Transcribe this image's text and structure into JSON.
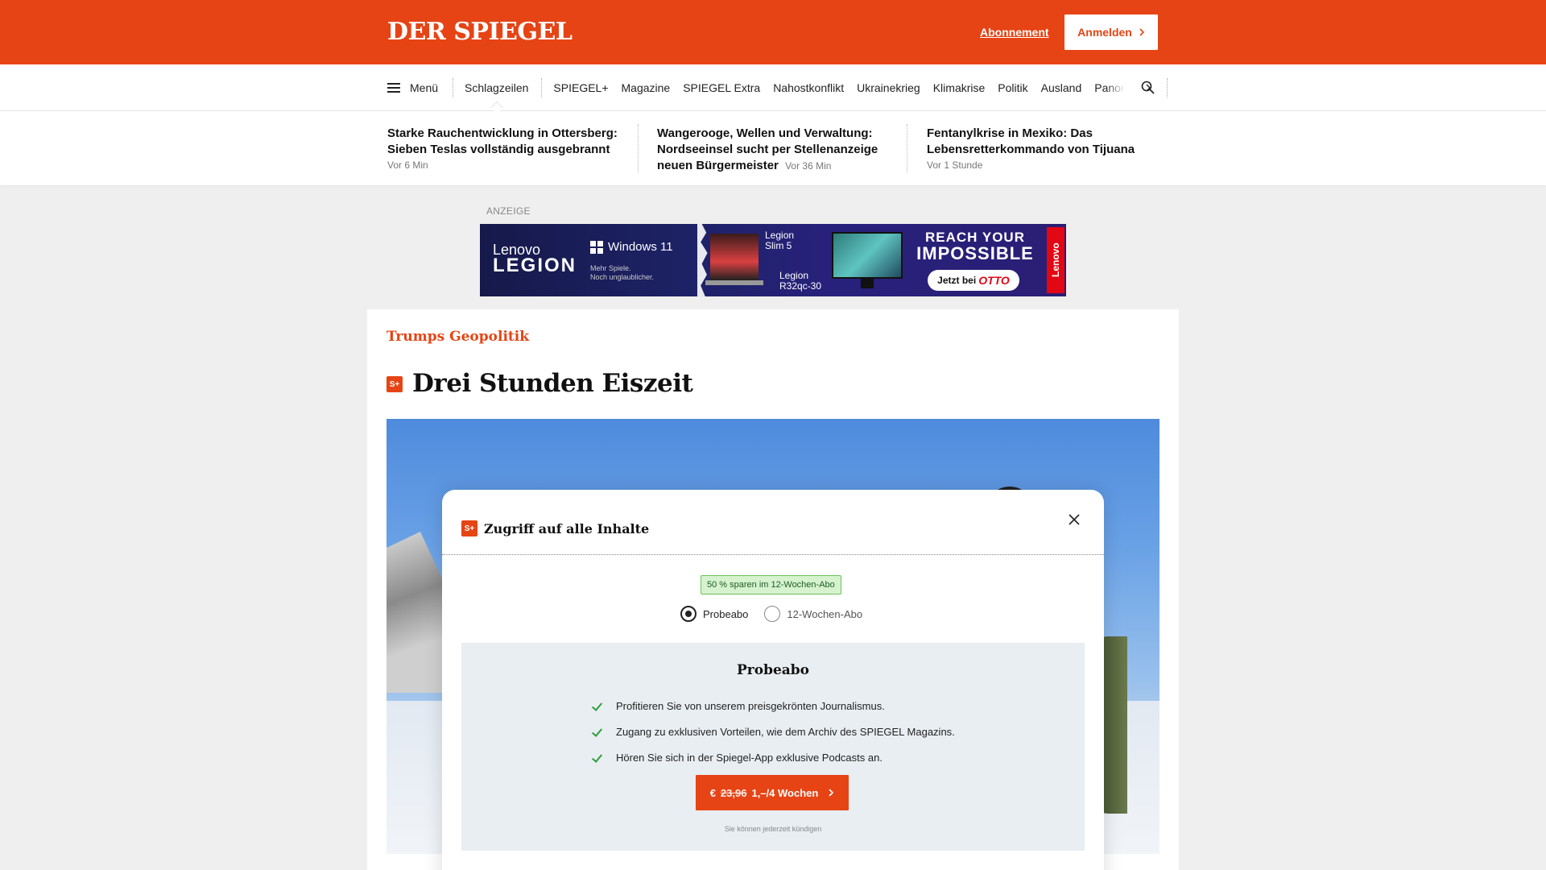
{
  "header": {
    "logo": "DER SPIEGEL",
    "subscription_link": "Abonnement",
    "login_label": "Anmelden",
    "brand_color": "#e64415"
  },
  "nav": {
    "menu_label": "Menü",
    "items": [
      "Schlagzeilen",
      "SPIEGEL+",
      "Magazine",
      "SPIEGEL Extra",
      "Nahostkonflikt",
      "Ukrainekrieg",
      "Klimakrise",
      "Politik",
      "Ausland",
      "Panor"
    ],
    "active_item": "Schlagzeilen",
    "more_icon": "chevron-right-icon",
    "search_icon": "search-icon"
  },
  "teasers": [
    {
      "title": "Starke Rauchentwicklung in Ottersberg: Sieben Teslas vollständig ausgebrannt",
      "time": "Vor 6 Min"
    },
    {
      "title": "Wangerooge, Wellen und Verwaltung: Nordseeinsel sucht per Stellenanzeige neuen Bürgermeister",
      "time": "Vor 36 Min"
    },
    {
      "title": "Fentanylkrise in Mexiko: Das Lebensretterkommando von Tijuana",
      "time": "Vor 1 Stunde"
    }
  ],
  "ad": {
    "label": "ANZEIGE",
    "brand_top": "Lenovo",
    "brand_main": "LEGION",
    "os": "Windows 11",
    "os_sub_1": "Mehr Spiele.",
    "os_sub_2": "Noch unglaublicher.",
    "product_1_a": "Legion",
    "product_1_b": "Slim 5",
    "product_2_a": "Legion",
    "product_2_b": "R32qc-30",
    "slogan_1": "REACH YOUR",
    "slogan_2": "IMPOSSIBLE",
    "cta_prefix": "Jetzt bei",
    "cta_shop": "OTTO",
    "side_brand": "Lenovo"
  },
  "article": {
    "kicker": "Trumps Geopolitik",
    "badge": "S+",
    "headline": "Drei Stunden Eiszeit"
  },
  "modal": {
    "badge": "S+",
    "title": "Zugriff auf alle Inhalte",
    "save_badge": "50 % sparen im 12-Wochen-Abo",
    "options": [
      {
        "label": "Probeabo",
        "selected": true
      },
      {
        "label": "12-Wochen-Abo",
        "selected": false
      }
    ],
    "plan_title": "Probeabo",
    "benefits": [
      "Profitieren Sie von unserem preisgekrönten Journalismus.",
      "Zugang zu exklusiven Vorteilen, wie dem Archiv des SPIEGEL Magazins.",
      "Hören Sie sich in der Spiegel-App exklusive Podcasts an."
    ],
    "cta_currency": "€",
    "cta_old_price": "23,96",
    "cta_new_price": "1,–/4 Wochen",
    "cancel_note": "Sie können jederzeit kündigen",
    "close_icon": "close-icon"
  }
}
